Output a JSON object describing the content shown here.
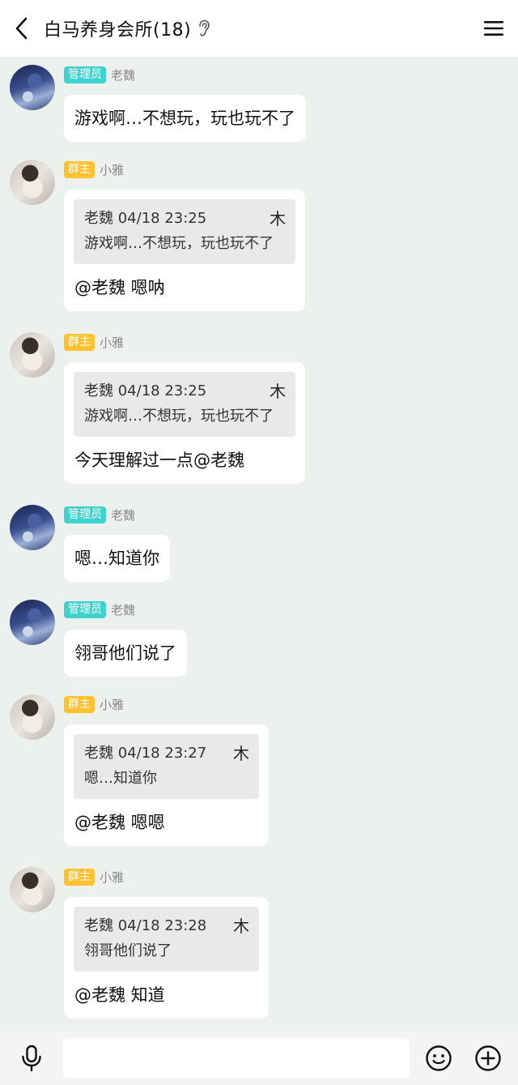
{
  "header": {
    "title": "白马养身会所(18)",
    "back_icon": "chevron-left-icon",
    "ear_icon": "ear-icon",
    "menu_icon": "hamburger-menu-icon"
  },
  "messages": [
    {
      "type": "text",
      "badge": "管理员",
      "sender": "老魏",
      "text": "游戏啊…不想玩，玩也玩不了"
    },
    {
      "type": "reply",
      "badge": "群主",
      "sender": "小雅",
      "quote_header": "老魏 04/18 23:25",
      "quote_text": "游戏啊…不想玩，玩也玩不了",
      "jump_glyph": "⽊",
      "text": "@老魏 嗯呐"
    },
    {
      "type": "reply",
      "badge": "群主",
      "sender": "小雅",
      "quote_header": "老魏 04/18 23:25",
      "quote_text": "游戏啊…不想玩，玩也玩不了",
      "jump_glyph": "⽊",
      "text": "今天理解过一点@老魏"
    },
    {
      "type": "text",
      "badge": "管理员",
      "sender": "老魏",
      "text": "嗯…知道你"
    },
    {
      "type": "text",
      "badge": "管理员",
      "sender": "老魏",
      "text": "翎哥他们说了"
    },
    {
      "type": "reply",
      "badge": "群主",
      "sender": "小雅",
      "quote_header": "老魏 04/18 23:27",
      "quote_text": "嗯…知道你",
      "jump_glyph": "⽊",
      "text": "@老魏 嗯嗯"
    },
    {
      "type": "reply",
      "badge": "群主",
      "sender": "小雅",
      "quote_header": "老魏 04/18 23:28",
      "quote_text": "翎哥他们说了",
      "jump_glyph": "⽊",
      "text": "@老魏 知道"
    }
  ],
  "input": {
    "placeholder": ""
  },
  "colors": {
    "admin_badge": "#3fd3cf",
    "owner_badge": "#ffc12e",
    "chat_bg": "#edf1ed"
  },
  "toolbar": {
    "mic_icon": "microphone-icon",
    "emoji_icon": "smiley-icon",
    "plus_icon": "plus-circle-icon"
  }
}
